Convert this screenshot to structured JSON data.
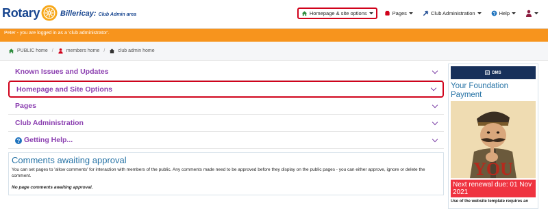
{
  "brand": {
    "name": "Rotary",
    "club": "Billericay:",
    "club_sub": "Club Admin area",
    "accent": "#17458f",
    "wheel_color": "#f7a81b"
  },
  "nav": {
    "items": [
      {
        "label": "Homepage & site options",
        "icon": "home-icon"
      },
      {
        "label": "Pages",
        "icon": "pages-icon"
      },
      {
        "label": "Club Administration",
        "icon": "tools-icon"
      },
      {
        "label": "Help",
        "icon": "help-icon"
      }
    ],
    "user_icon": "user-avatar-icon"
  },
  "banner": {
    "text": "Peter - you are logged in as a 'club administrator'.",
    "color": "#f7941d"
  },
  "breadcrumb": {
    "items": [
      "PUBLIC home",
      "members home",
      "club admin home"
    ]
  },
  "accordion": {
    "items": [
      "Known Issues and Updates",
      "Homepage and Site Options",
      "Pages",
      "Club Administration",
      "Getting Help..."
    ],
    "title_color": "#8b3fb0"
  },
  "comments": {
    "title": "Comments awaiting approval",
    "text": "You can set pages to 'allow comments' for interaction with members of the public. Any comments made need to be approved before they display on the public pages - you can either approve, ignore or delete the comment.",
    "empty": "No page comments awaiting approval."
  },
  "sidebar": {
    "dms_label": "DMS",
    "heading": "Your Foundation Payment",
    "poster_text": "YOU",
    "renewal": "Next renewal due: 01 Nov 2021",
    "note": "Use of the website template requires an"
  }
}
